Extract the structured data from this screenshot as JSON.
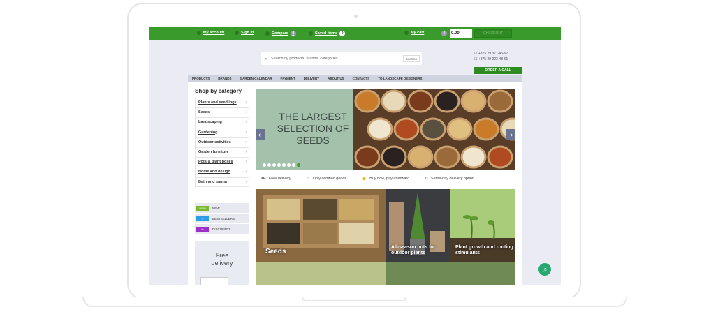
{
  "topbar": {
    "my_account": "My account",
    "sign_in": "Sign in",
    "compare": "Compare",
    "compare_count": "0",
    "saved_items": "Saved items",
    "saved_count": "0",
    "my_cart": "My cart",
    "cart_count": "0",
    "cart_total": "0.00",
    "checkout": "CHECKOUT"
  },
  "search": {
    "placeholder": "Search by products, brands, categories",
    "button": "SEARCH"
  },
  "contacts": {
    "phone1": "+375 29 377-45-97",
    "phone2": "+375 29 223-48-01",
    "order_call": "ORDER A CALL"
  },
  "nav": [
    "PRODUCTS",
    "BRANDS",
    "GARDEN CALENDAR",
    "PAYMENT",
    "DELIVERY",
    "ABOUT US",
    "CONTACTS",
    "TO LANDSCAPE DESIGNERS"
  ],
  "sidebar": {
    "heading": "Shop by category",
    "categories": [
      "Plants and seedlings",
      "Seeds",
      "Landscaping",
      "Gardening",
      "Outdoor activities",
      "Garden furniture",
      "Pots & plant boxes",
      "Home and design",
      "Bath and sauna"
    ],
    "tags": [
      {
        "flag": "NEW",
        "label": "NEW",
        "color": "#7cb82f"
      },
      {
        "flag": "☆",
        "label": "BESTSELLERS",
        "color": "#2b9ee6"
      },
      {
        "flag": "%",
        "label": "DISCOUNTS",
        "color": "#9b2fc8"
      }
    ],
    "free_delivery": "Free delivery"
  },
  "slider": {
    "title": "THE LARGEST SELECTION OF SEEDS",
    "dot_count": 8,
    "active_dot": 8
  },
  "features": [
    "Free delivery",
    "Only certified goods",
    "Buy now, pay afterward",
    "Same-day delivery option"
  ],
  "tiles": {
    "seeds": "Seeds",
    "pots": "All-season pots for outdoor plants",
    "growth": "Plant growth and rooting stimulants"
  },
  "colors": {
    "brand_green": "#3a9a2b",
    "nav_bg": "#d0d3e0",
    "bell": "#26a96e"
  }
}
